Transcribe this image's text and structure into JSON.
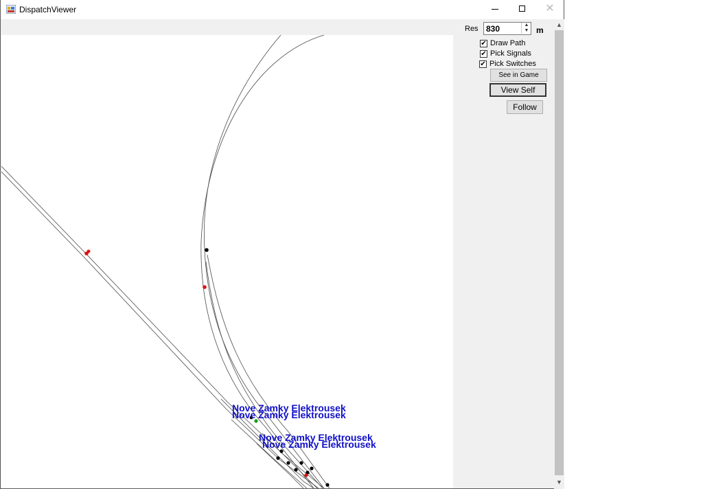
{
  "window": {
    "title": "DispatchViewer",
    "controls": {
      "minimize": "—",
      "maximize": "☐",
      "close": "✕"
    }
  },
  "map": {
    "station_labels": [
      "Nove Zamky Elektrousek",
      "Nove Zamky Elektrousek",
      "Nove Zamky Elektrousek",
      "Nove Zamky Elektrousek"
    ],
    "colors": {
      "track": "#4a4a4a",
      "signal_black": "#000000",
      "signal_red": "#e01010",
      "signal_green": "#10a010",
      "label": "#1010c8"
    }
  },
  "controls": {
    "res_label": "Res",
    "res_value": "830",
    "res_unit": "m",
    "spin_up": "▲",
    "spin_down": "▼",
    "checkboxes": [
      {
        "label": "Draw Path",
        "checked": true
      },
      {
        "label": "Pick Signals",
        "checked": true
      },
      {
        "label": "Pick Switches",
        "checked": true
      }
    ],
    "buttons": {
      "see_in_game": "See in Game",
      "view_self": "View Self",
      "follow": "Follow"
    },
    "check_mark": "✔"
  },
  "scrollbar": {
    "up": "▲",
    "down": "▼"
  }
}
